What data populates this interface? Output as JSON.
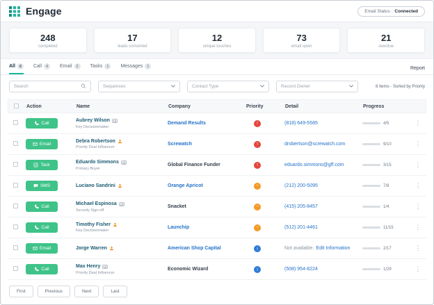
{
  "colors": {
    "accent_green": "#3FC389",
    "teal": "#14B8A0",
    "priority_high": "#E5453C",
    "priority_medium": "#F49A25",
    "priority_low": "#2E7CD6",
    "link_blue": "#2472C8"
  },
  "header": {
    "title": "Engage",
    "email_status_label": "Email Status :",
    "email_status_value": "Connected"
  },
  "stats": [
    {
      "value": "248",
      "label": "completed"
    },
    {
      "value": "17",
      "label": "leads converted"
    },
    {
      "value": "12",
      "label": "unique touches"
    },
    {
      "value": "73",
      "label": "email open"
    },
    {
      "value": "21",
      "label": "overdue"
    }
  ],
  "tabs": [
    {
      "label": "All",
      "count": "8",
      "active": true
    },
    {
      "label": "Call",
      "count": "4",
      "active": false
    },
    {
      "label": "Email",
      "count": "2",
      "active": false
    },
    {
      "label": "Tasks",
      "count": "1",
      "active": false
    },
    {
      "label": "Messages",
      "count": "1",
      "active": false
    }
  ],
  "report_label": "Report",
  "filters": {
    "search_placeholder": "Search",
    "sequences_label": "Sequences",
    "contact_type_label": "Contact Type",
    "record_owner_label": "Record Owner",
    "summary": "8 Items - Sorted by Priority"
  },
  "table": {
    "columns": {
      "action": "Action",
      "name": "Name",
      "company": "Company",
      "priority": "Priority",
      "detail": "Detail",
      "progress": "Progress"
    },
    "rows": [
      {
        "action_label": "Call",
        "action_icon": "phone-icon",
        "name": "Aubrey Wilson",
        "name_icon": "id-card-icon",
        "role": "Key Decisionmaker",
        "company": "Demand Results",
        "company_is_link": true,
        "priority": "high",
        "detail_text": "",
        "detail_link": "(818) 649-5585",
        "progress_label": "4/5",
        "progress_pct": 80
      },
      {
        "action_label": "Email",
        "action_icon": "mail-icon",
        "name": "Debra Robertson",
        "name_icon": "person-icon",
        "role": "Priority Deal Influencer",
        "company": "Screwatch",
        "company_is_link": true,
        "priority": "high",
        "detail_text": "",
        "detail_link": "drobertson@screwatch.com",
        "progress_label": "9/10",
        "progress_pct": 90
      },
      {
        "action_label": "Task",
        "action_icon": "task-icon",
        "name": "Eduardo Simmons",
        "name_icon": "id-card-icon",
        "role": "Primary Buyer",
        "company": "Global Finance Funder",
        "company_is_link": false,
        "priority": "high",
        "detail_text": "",
        "detail_link": "eduardo.simmons@gff.com",
        "progress_label": "3/15",
        "progress_pct": 20
      },
      {
        "action_label": "SMS",
        "action_icon": "chat-icon",
        "name": "Luciano Sandrini",
        "name_icon": "person-icon",
        "role": "",
        "company": "Orange Apricot",
        "company_is_link": true,
        "priority": "medium",
        "detail_text": "",
        "detail_link": "(212) 200-5095",
        "progress_label": "7/8",
        "progress_pct": 88
      },
      {
        "action_label": "Call",
        "action_icon": "phone-icon",
        "name": "Michael Espinosa",
        "name_icon": "id-card-icon",
        "role": "Security Sign-off",
        "company": "Snacket",
        "company_is_link": false,
        "priority": "medium",
        "detail_text": "",
        "detail_link": "(415) 205-8457",
        "progress_label": "1/4",
        "progress_pct": 25
      },
      {
        "action_label": "Call",
        "action_icon": "phone-icon",
        "name": "Timothy Fisher",
        "name_icon": "person-icon",
        "role": "Key Decisionmaker",
        "company": "Launchip",
        "company_is_link": true,
        "priority": "medium",
        "detail_text": "",
        "detail_link": "(512) 201-4461",
        "progress_label": "11/15",
        "progress_pct": 73
      },
      {
        "action_label": "Email",
        "action_icon": "mail-icon",
        "name": "Jorge Warren",
        "name_icon": "person-icon",
        "role": "",
        "company": "American Shop Capital",
        "company_is_link": true,
        "priority": "low",
        "detail_text": "Not available.",
        "detail_link": "Edit Information",
        "progress_label": "2/17",
        "progress_pct": 12
      },
      {
        "action_label": "Call",
        "action_icon": "phone-icon",
        "name": "Max Henry",
        "name_icon": "id-card-icon",
        "role": "Priority Deal Influencer",
        "company": "Economic Wizard",
        "company_is_link": false,
        "priority": "low",
        "detail_text": "",
        "detail_link": "(508) 954-8224",
        "progress_label": "1/29",
        "progress_pct": 3
      }
    ]
  },
  "pagination": {
    "first": "First",
    "previous": "Previous",
    "next": "Next",
    "last": "Last"
  }
}
